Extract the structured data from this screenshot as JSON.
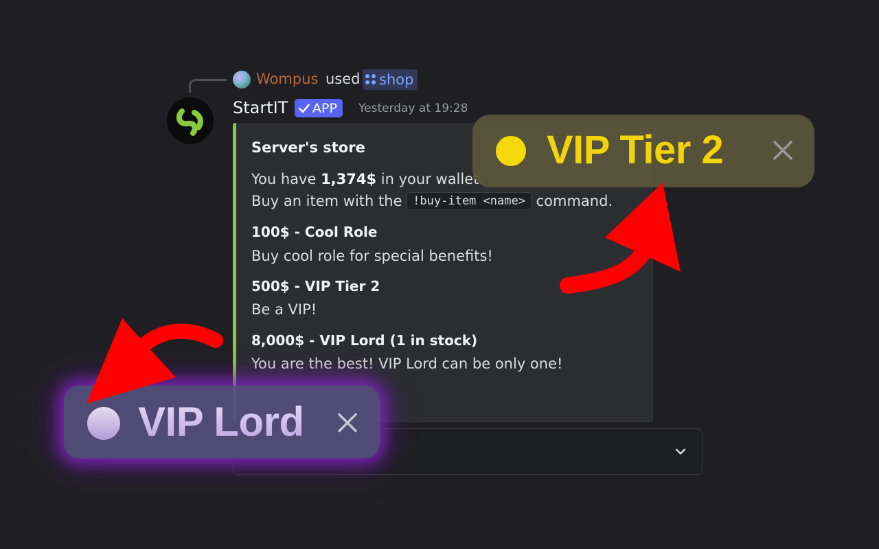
{
  "reply": {
    "username": "Wompus",
    "used_text": "used",
    "command": "shop",
    "command_icon": "slash-command-dots-icon"
  },
  "message": {
    "bot_name": "StartIT",
    "app_badge": "APP",
    "timestamp": "Yesterday at 19:28",
    "embed_color": "#88c940"
  },
  "embed": {
    "title": "Server's store",
    "wallet_prefix": "You have ",
    "wallet_amount": "1,374$",
    "wallet_suffix": " in your wallet.",
    "buy_prefix": "Buy an item with the ",
    "buy_command": "!buy-item <name>",
    "buy_suffix": " command.",
    "items": [
      {
        "name": "100$ - Cool Role",
        "description": "Buy cool role for special benefits!"
      },
      {
        "name": "500$ - VIP Tier 2",
        "description": "Be a VIP!"
      },
      {
        "name": "8,000$ - VIP Lord (1 in stock)",
        "description": "You are the best! VIP Lord can be only one!"
      }
    ]
  },
  "select_menu": {
    "chevron_icon": "chevron-down-icon"
  },
  "tags": {
    "tier2": {
      "label": "VIP Tier 2",
      "dot_color": "#f5d90a",
      "text_color": "#f2d40b"
    },
    "lord": {
      "label": "VIP Lord",
      "glow_color": "#8c28d2"
    }
  },
  "colors": {
    "background": "#1f1f23",
    "app_badge": "#5865f2",
    "arrow": "#ff0000"
  }
}
